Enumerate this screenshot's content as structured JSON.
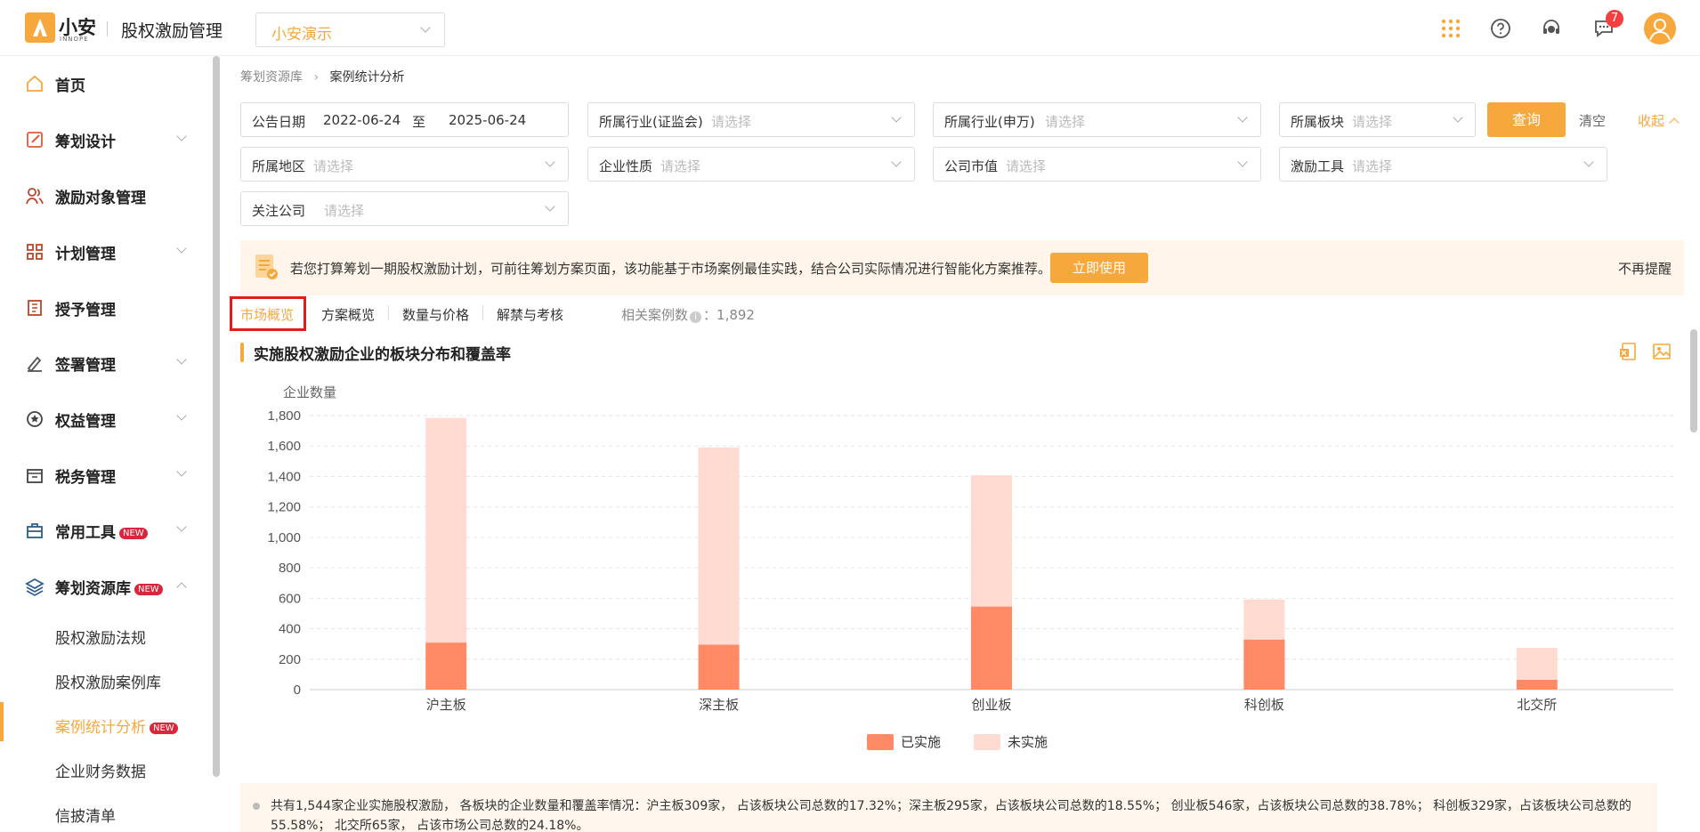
{
  "header": {
    "logo_name": "小安",
    "logo_sub": "INNOPE",
    "app_title": "股权激励管理",
    "company_select": "小安演示",
    "message_count": "7"
  },
  "sidebar": {
    "items": [
      {
        "label": "首页",
        "icon": "home-icon"
      },
      {
        "label": "筹划设计",
        "icon": "edit-icon"
      },
      {
        "label": "激励对象管理",
        "icon": "users-icon"
      },
      {
        "label": "计划管理",
        "icon": "grid-icon"
      },
      {
        "label": "授予管理",
        "icon": "book-icon"
      },
      {
        "label": "签署管理",
        "icon": "sign-icon"
      },
      {
        "label": "权益管理",
        "icon": "badge-icon"
      },
      {
        "label": "税务管理",
        "icon": "tax-icon"
      },
      {
        "label": "常用工具",
        "icon": "toolbox-icon",
        "tag": "NEW"
      },
      {
        "label": "筹划资源库",
        "icon": "layers-icon",
        "tag": "NEW"
      }
    ],
    "sub_items": [
      {
        "label": "股权激励法规"
      },
      {
        "label": "股权激励案例库"
      },
      {
        "label": "案例统计分析",
        "tag": "NEW",
        "active": true
      },
      {
        "label": "企业财务数据"
      },
      {
        "label": "信披清单"
      }
    ]
  },
  "breadcrumb": {
    "parent": "筹划资源库",
    "current": "案例统计分析"
  },
  "filters": {
    "date_label": "公告日期",
    "date_from": "2022-06-24",
    "date_to_sep": "至",
    "date_to": "2025-06-24",
    "industry_csrc": "所属行业(证监会)",
    "industry_sw": "所属行业(申万)",
    "board": "所属板块",
    "region": "所属地区",
    "nature": "企业性质",
    "market_cap": "公司市值",
    "tool": "激励工具",
    "follow": "关注公司",
    "placeholder": "请选择",
    "query": "查询",
    "clear": "清空",
    "collapse": "收起"
  },
  "banner": {
    "text": "若您打算筹划一期股权激励计划，可前往筹划方案页面，该功能基于市场案例最佳实践，结合公司实际情况进行智能化方案推荐。",
    "button": "立即使用",
    "dismiss": "不再提醒"
  },
  "tabs": [
    {
      "label": "市场概览",
      "active": true
    },
    {
      "label": "方案概览"
    },
    {
      "label": "数量与价格"
    },
    {
      "label": "解禁与考核"
    }
  ],
  "case_count_label": "相关案例数",
  "case_count": "1,892",
  "section_title": "实施股权激励企业的板块分布和覆盖率",
  "chart_data": {
    "type": "bar",
    "stacked": true,
    "ylabel": "企业数量",
    "ylim": [
      0,
      1800
    ],
    "yticks": [
      "0",
      "200",
      "400",
      "600",
      "800",
      "1,000",
      "1,200",
      "1,400",
      "1,600",
      "1,800"
    ],
    "categories": [
      "沪主板",
      "深主板",
      "创业板",
      "科创板",
      "北交所"
    ],
    "series": [
      {
        "name": "已实施",
        "values": [
          309,
          295,
          546,
          329,
          65
        ],
        "color": "#ff8a65"
      },
      {
        "name": "未实施",
        "values": [
          1475,
          1295,
          862,
          263,
          209
        ],
        "color": "#ffdbd2"
      }
    ],
    "grid": true,
    "legend_position": "bottom"
  },
  "summary": "共有1,544家企业实施股权激励， 各板块的企业数量和覆盖率情况：沪主板309家， 占该板块公司总数的17.32%；深主板295家，占该板块公司总数的18.55%； 创业板546家，占该板块公司总数的38.78%； 科创板329家，占该板块公司总数的55.58%； 北交所65家， 占该市场公司总数的24.18%。"
}
